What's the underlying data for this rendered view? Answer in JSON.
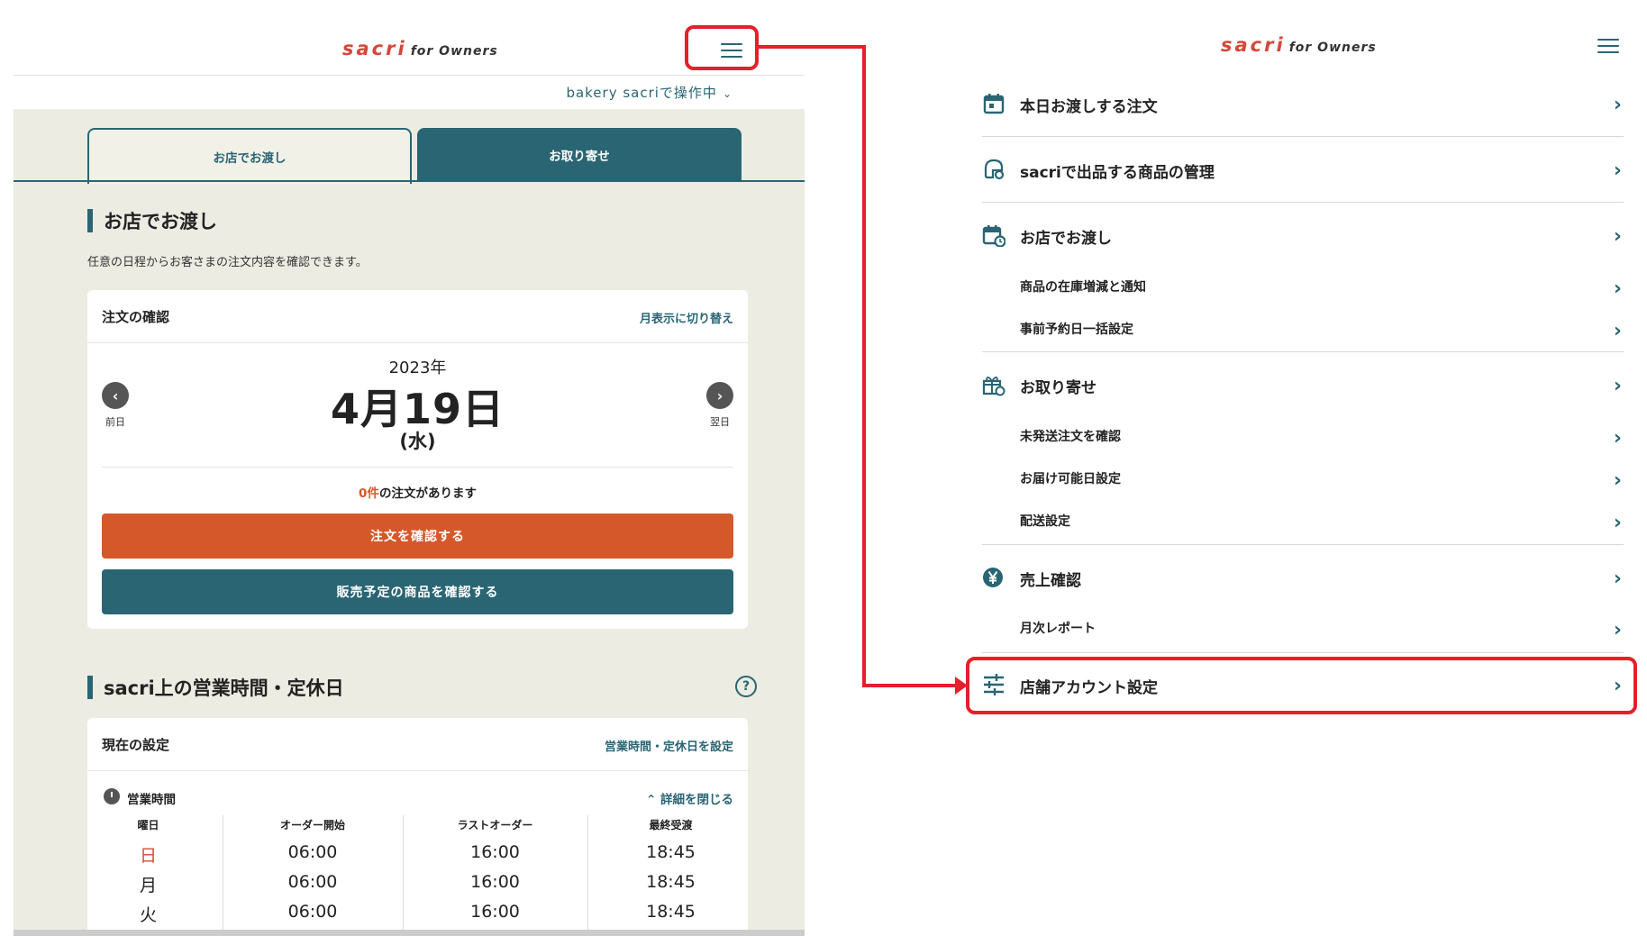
{
  "brand": {
    "name": "sacri",
    "suffix": "for Owners"
  },
  "left": {
    "store_switch": "bakery sacriで操作中",
    "tabs": [
      {
        "label": "お店でお渡し",
        "active": true
      },
      {
        "label": "お取り寄せ",
        "active": false
      }
    ],
    "section1": {
      "title": "お店でお渡し",
      "description": "任意の日程からお客さまの注文内容を確認できます。",
      "card": {
        "title": "注文の確認",
        "toggle_link": "月表示に切り替え",
        "year": "2023年",
        "date": "4月19日",
        "weekday": "(水)",
        "prev_label": "前日",
        "next_label": "翌日",
        "count_number": "0件",
        "count_text": "の注文があります",
        "confirm_button": "注文を確認する",
        "products_button": "販売予定の商品を確認する"
      }
    },
    "section2": {
      "title": "sacri上の営業時間・定休日",
      "card": {
        "title": "現在の設定",
        "set_link": "営業時間・定休日を設定",
        "hours_label": "営業時間",
        "collapse_link": "詳細を閉じる",
        "columns": [
          "曜日",
          "オーダー開始",
          "ラストオーダー",
          "最終受渡"
        ],
        "rows": [
          [
            "日",
            "06:00",
            "16:00",
            "18:45"
          ],
          [
            "月",
            "06:00",
            "16:00",
            "18:45"
          ],
          [
            "火",
            "06:00",
            "16:00",
            "18:45"
          ]
        ]
      }
    }
  },
  "menu": {
    "items": [
      {
        "label": "本日お渡しする注文",
        "icon": "calendar-today-icon",
        "type": "main"
      },
      {
        "label": "sacriで出品する商品の管理",
        "icon": "product-settings-icon",
        "type": "main"
      },
      {
        "label": "お店でお渡し",
        "icon": "calendar-clock-icon",
        "type": "main"
      },
      {
        "label": "商品の在庫増減と通知",
        "type": "sub"
      },
      {
        "label": "事前予約日一括設定",
        "type": "sub"
      },
      {
        "label": "お取り寄せ",
        "icon": "gift-settings-icon",
        "type": "main"
      },
      {
        "label": "未発送注文を確認",
        "type": "sub"
      },
      {
        "label": "お届け可能日設定",
        "type": "sub"
      },
      {
        "label": "配送設定",
        "type": "sub"
      },
      {
        "label": "売上確認",
        "icon": "yen-icon",
        "type": "main"
      },
      {
        "label": "月次レポート",
        "type": "sub"
      },
      {
        "label": "店舗アカウント設定",
        "icon": "sliders-icon",
        "type": "main"
      }
    ]
  },
  "colors": {
    "accent": "#2a6573",
    "brand": "#d4483a",
    "cta": "#d5582a",
    "highlight": "#e3202b",
    "beige": "#edece2",
    "sunday": "#d4483a"
  }
}
